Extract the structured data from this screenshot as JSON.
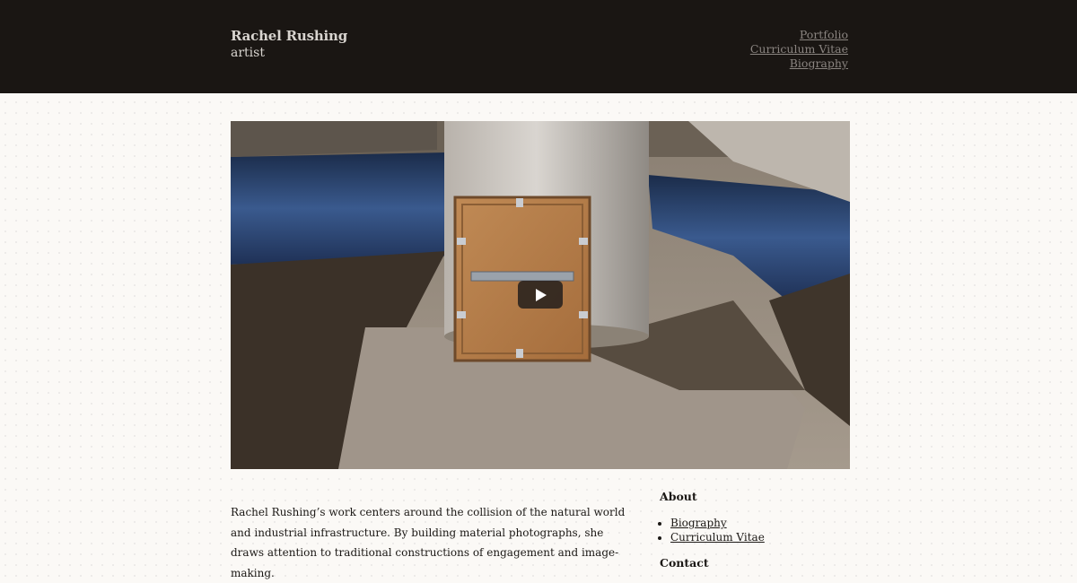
{
  "header": {
    "site_title": "Rachel Rushing",
    "tagline": "artist",
    "nav": [
      {
        "label": "Portfolio"
      },
      {
        "label": "Curriculum Vitae"
      },
      {
        "label": "Biography"
      }
    ]
  },
  "video": {
    "play_icon": "play-icon"
  },
  "intro": {
    "text": "Rachel Rushing’s work centers around the collision of the natural world and industrial infrastructure. By building material photographs, she draws attention to traditional constructions of engagement and image-making."
  },
  "sidebar": {
    "about_heading": "About",
    "about_links": [
      {
        "label": "Biography"
      },
      {
        "label": "Curriculum Vitae"
      }
    ],
    "contact_heading": "Contact"
  }
}
